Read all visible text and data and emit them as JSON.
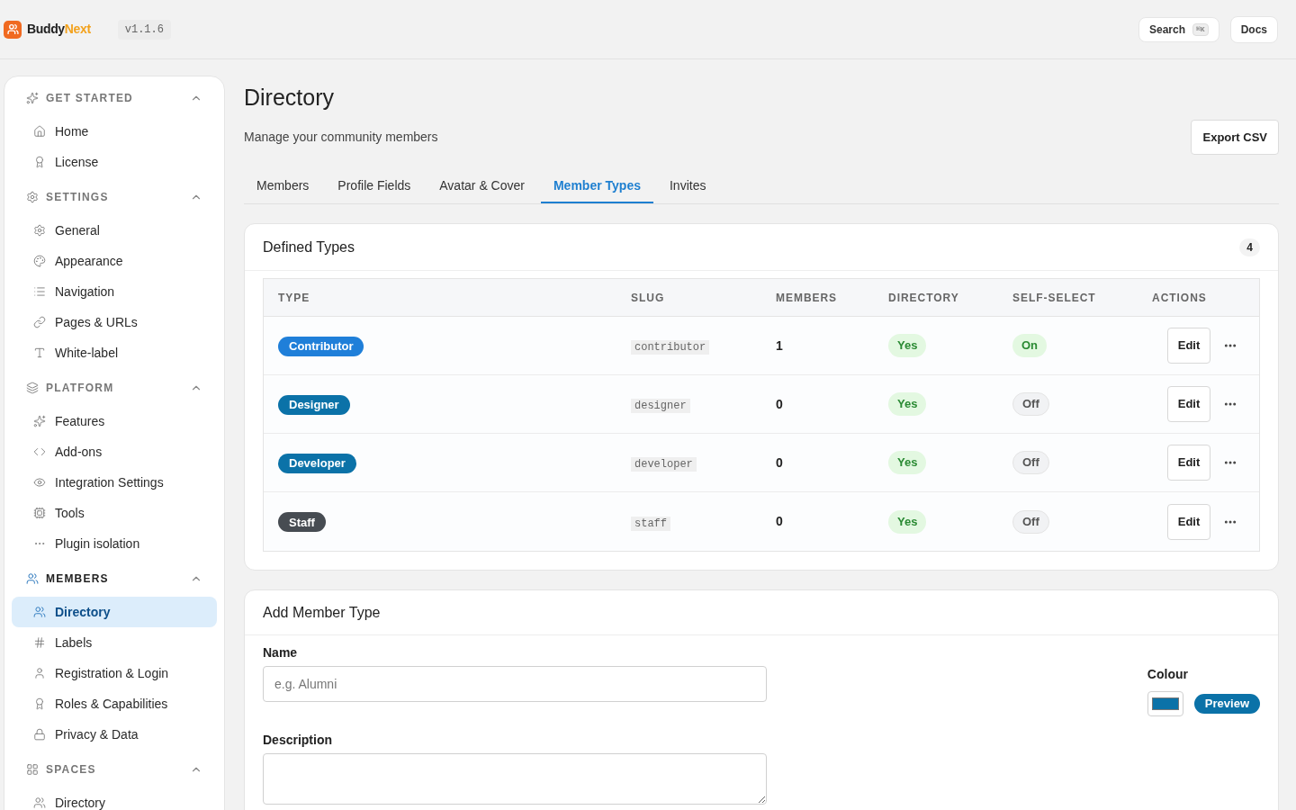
{
  "header": {
    "brand_first": "Buddy",
    "brand_second": "Next",
    "version": "v1.1.6",
    "search": {
      "label": "Search",
      "shortcut": "⌘K"
    },
    "docs": "Docs"
  },
  "sidebar": {
    "sections": [
      {
        "title": "GET STARTED",
        "expanded": true,
        "items": [
          {
            "label": "Home",
            "selected": false
          },
          {
            "label": "License",
            "selected": false
          }
        ]
      },
      {
        "title": "SETTINGS",
        "expanded": true,
        "items": [
          {
            "label": "General",
            "selected": false
          },
          {
            "label": "Appearance",
            "selected": false
          },
          {
            "label": "Navigation",
            "selected": false
          },
          {
            "label": "Pages & URLs",
            "selected": false
          },
          {
            "label": "White-label",
            "selected": false
          }
        ]
      },
      {
        "title": "PLATFORM",
        "expanded": true,
        "items": [
          {
            "label": "Features",
            "selected": false
          },
          {
            "label": "Add-ons",
            "selected": false
          },
          {
            "label": "Integration Settings",
            "selected": false
          },
          {
            "label": "Tools",
            "selected": false
          },
          {
            "label": "Plugin isolation",
            "selected": false
          }
        ]
      },
      {
        "title": "MEMBERS",
        "expanded": true,
        "items": [
          {
            "label": "Directory",
            "selected": true
          },
          {
            "label": "Labels",
            "selected": false
          },
          {
            "label": "Registration & Login",
            "selected": false
          },
          {
            "label": "Roles & Capabilities",
            "selected": false
          },
          {
            "label": "Privacy & Data",
            "selected": false
          }
        ]
      },
      {
        "title": "SPACES",
        "expanded": true,
        "items": [
          {
            "label": "Directory",
            "selected": false
          }
        ]
      }
    ]
  },
  "page": {
    "title": "Directory",
    "subtitle": "Manage your community members",
    "export_button": "Export CSV"
  },
  "tabs": [
    {
      "label": "Members",
      "selected": false
    },
    {
      "label": "Profile Fields",
      "selected": false
    },
    {
      "label": "Avatar & Cover",
      "selected": false
    },
    {
      "label": "Member Types",
      "selected": true
    },
    {
      "label": "Invites",
      "selected": false
    }
  ],
  "defined_types": {
    "title": "Defined Types",
    "count": "4",
    "table": {
      "columns": [
        "TYPE",
        "SLUG",
        "MEMBERS",
        "DIRECTORY",
        "SELF-SELECT",
        "ACTIONS"
      ],
      "rows": [
        {
          "type": "Contributor",
          "color": "#1f7fd9",
          "slug": "contributor",
          "members": "1",
          "directory": "Yes",
          "self_select": {
            "label": "On",
            "on": true
          },
          "edit": "Edit"
        },
        {
          "type": "Designer",
          "color": "#0b72a8",
          "slug": "designer",
          "members": "0",
          "directory": "Yes",
          "self_select": {
            "label": "Off",
            "on": false
          },
          "edit": "Edit"
        },
        {
          "type": "Developer",
          "color": "#0b72a8",
          "slug": "developer",
          "members": "0",
          "directory": "Yes",
          "self_select": {
            "label": "Off",
            "on": false
          },
          "edit": "Edit"
        },
        {
          "type": "Staff",
          "color": "#474c52",
          "slug": "staff",
          "members": "0",
          "directory": "Yes",
          "self_select": {
            "label": "Off",
            "on": false
          },
          "edit": "Edit"
        }
      ]
    }
  },
  "add_member_type": {
    "title": "Add Member Type",
    "name_label": "Name",
    "name_placeholder": "e.g. Alumni",
    "description_label": "Description",
    "colour_label": "Colour",
    "color": "#0b72a8",
    "preview": "Preview"
  }
}
